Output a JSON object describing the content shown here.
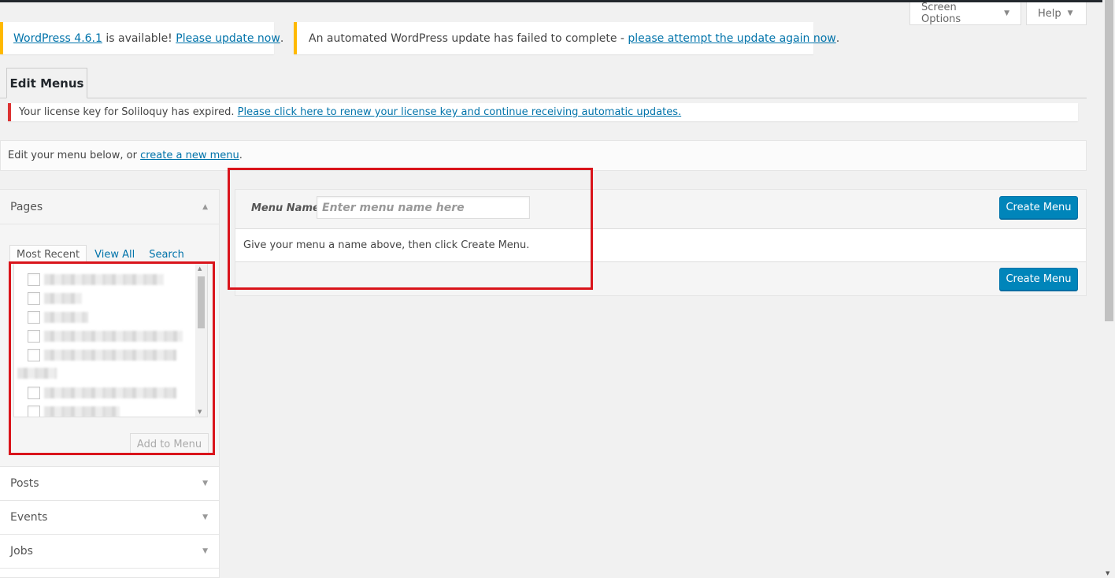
{
  "screen_meta": {
    "screen_options_label": "Screen Options",
    "help_label": "Help"
  },
  "notices": {
    "update": {
      "link1": "WordPress 4.6.1",
      "text": " is available! ",
      "link2": "Please update now",
      "tail": "."
    },
    "failed": {
      "text": "An automated WordPress update has failed to complete - ",
      "link": "please attempt the update again now",
      "tail": "."
    },
    "license": {
      "text": "Your license key for Soliloquy has expired. ",
      "link": "Please click here to renew your license key and continue receiving automatic updates."
    }
  },
  "tabs": {
    "edit_menus": "Edit Menus"
  },
  "manage": {
    "text": "Edit your menu below, or ",
    "link": "create a new menu",
    "tail": "."
  },
  "accordion": {
    "pages": {
      "title": "Pages",
      "subtabs": [
        "Most Recent",
        "View All",
        "Search"
      ],
      "add_button": "Add to Menu"
    },
    "sections": [
      "Posts",
      "Events",
      "Jobs"
    ]
  },
  "menu_edit": {
    "name_label": "Menu Name",
    "name_placeholder": "Enter menu name here",
    "create_label": "Create Menu",
    "instructions": "Give your menu a name above, then click Create Menu."
  },
  "colors": {
    "accent": "#0085ba",
    "link": "#0073aa",
    "warning": "#ffb900",
    "error": "#dc3232",
    "highlight": "#d9141b"
  }
}
